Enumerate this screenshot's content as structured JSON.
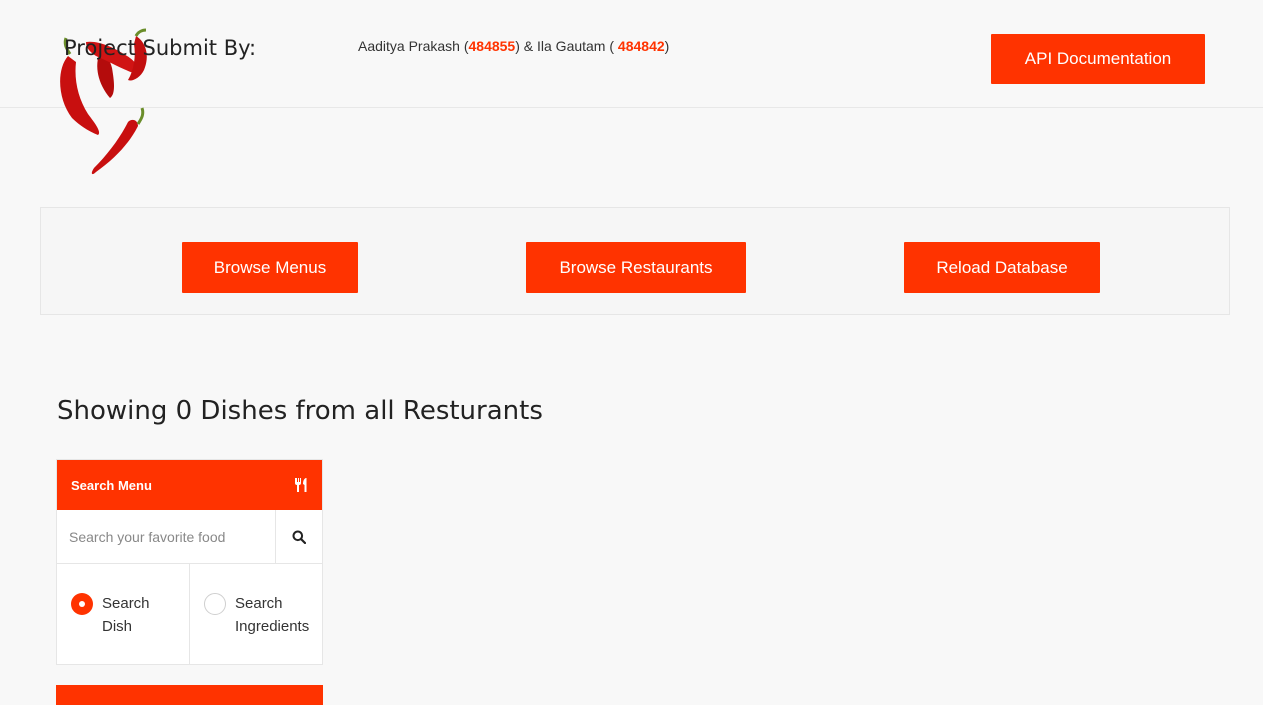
{
  "header": {
    "submit_label": "Project Submit By:",
    "author1_name": "Aaditya Prakash (",
    "author1_id": "484855",
    "joiner": ") & Ila Gautam ( ",
    "author2_id": "484842",
    "closing": ")",
    "api_button": "API Documentation"
  },
  "actions": {
    "browse_menus": "Browse Menus",
    "browse_restaurants": "Browse Restaurants",
    "reload_database": "Reload Database"
  },
  "main": {
    "heading": "Showing 0 Dishes from all Resturants"
  },
  "search_card": {
    "title": "Search Menu",
    "title_icon": "fork-knife-icon",
    "placeholder": "Search your favorite food",
    "search_icon": "search-icon",
    "options": [
      {
        "label_line1": "Search",
        "label_line2": "Dish",
        "selected": true
      },
      {
        "label_line1": "Search",
        "label_line2": "Ingredients",
        "selected": false
      }
    ]
  },
  "colors": {
    "accent": "#ff3300",
    "background": "#f8f8f8"
  }
}
